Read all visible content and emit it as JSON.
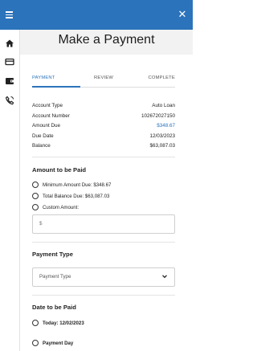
{
  "header": {
    "menu_icon": "menu-icon",
    "close_label": "✕",
    "bg": "#2b73bb"
  },
  "sidebar": {
    "items": [
      "home-icon",
      "card-icon",
      "wallet-icon",
      "phone-icon"
    ]
  },
  "page": {
    "title": "Make a Payment"
  },
  "tabs": [
    "PAYMENT",
    "REVIEW",
    "COMPLETE"
  ],
  "account": [
    {
      "label": "Account Type",
      "value": "Auto Loan"
    },
    {
      "label": "Account Number",
      "value": "102672027150"
    },
    {
      "label": "Amount Due",
      "value": "$348.67"
    },
    {
      "label": "Due Date",
      "value": "12/03/2023"
    },
    {
      "label": "Balance",
      "value": "$63,087.03"
    }
  ],
  "amount_section": {
    "heading": "Amount to be Paid",
    "options": [
      "Minimum Amount Due: $348.67",
      "Total Balance Due: $63,087.03",
      "Custom Amount:"
    ],
    "custom_placeholder": "$"
  },
  "payment_type": {
    "heading": "Payment Type",
    "placeholder": "Payment Type"
  },
  "date_section": {
    "heading": "Date to be Paid",
    "options": [
      "Today: 12/02/2023",
      "Payment Day"
    ]
  },
  "colors": {
    "accent": "#2b73bb"
  }
}
